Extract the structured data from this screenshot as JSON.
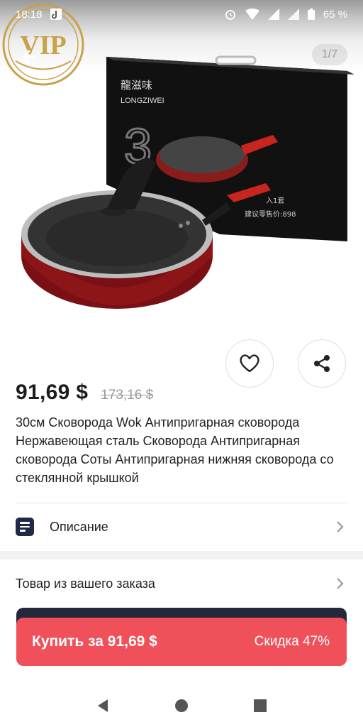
{
  "status_bar": {
    "time": "18:18",
    "battery": "65 %",
    "icons": [
      "tiktok-icon",
      "alarm-icon",
      "wifi-icon",
      "signal-icon",
      "battery-icon"
    ]
  },
  "badge": {
    "text": "VIP",
    "color": "#c9a24a"
  },
  "gallery": {
    "indicator": "1/7"
  },
  "product_image": {
    "brand_cn": "龍滋味",
    "brand": "LONGZIWEI",
    "box_number": "3",
    "box_price_text": "建议零售价:898",
    "box_count_text": "入1套"
  },
  "price": {
    "current": "91,69 $",
    "old": "173,16 $"
  },
  "title": "30см Сковорода Wok Антипригарная сковорода Нержавеющая сталь Сковорода Антипригарная сковорода Соты Антипригарная нижняя сковорода со стеклянной крышкой",
  "rows": {
    "description": "Описание",
    "order_item": "Товар из вашего заказа"
  },
  "buy": {
    "label": "Купить за 91,69 $",
    "discount": "Скидка 47%",
    "color": "#f0505a"
  },
  "nav": {
    "icons": [
      "back-triangle-icon",
      "home-circle-icon",
      "recents-square-icon"
    ]
  }
}
